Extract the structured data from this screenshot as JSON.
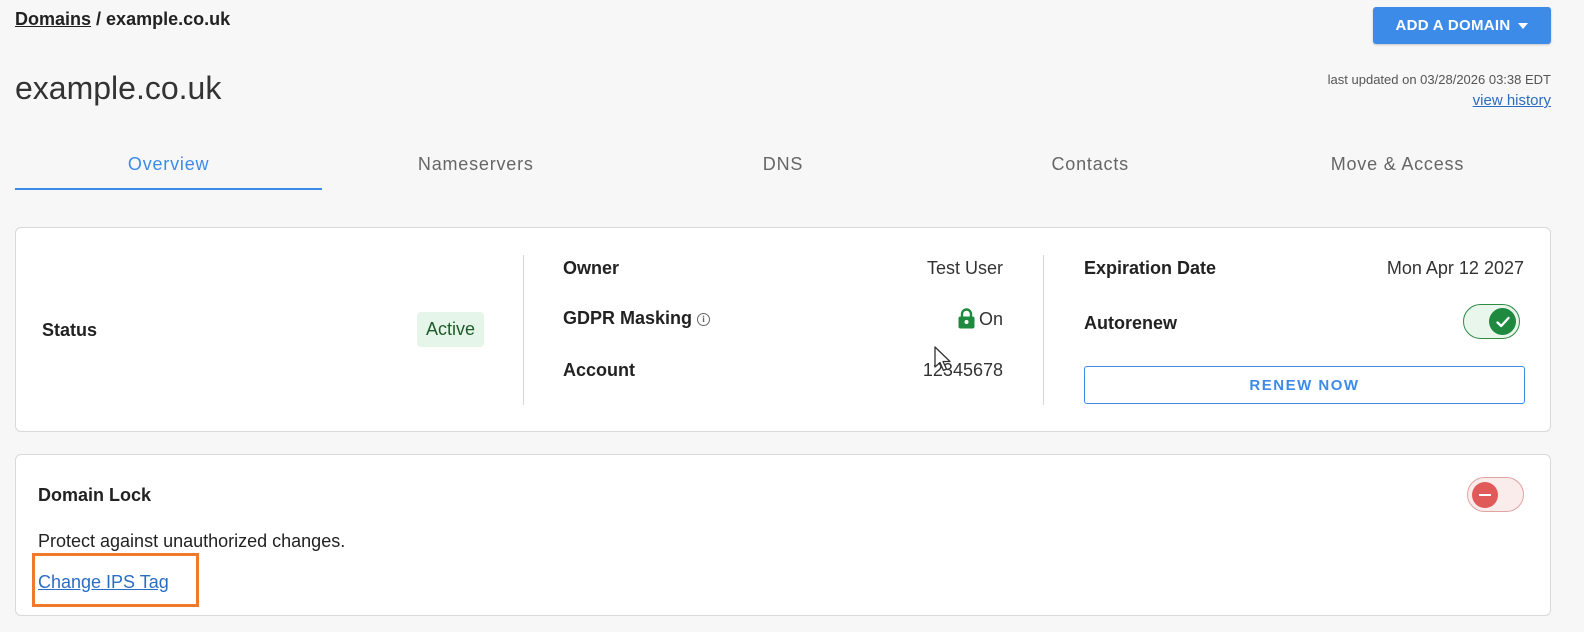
{
  "breadcrumb": {
    "root": "Domains",
    "separator": " / ",
    "current": "example.co.uk"
  },
  "header": {
    "add_domain_label": "ADD A DOMAIN",
    "title": "example.co.uk",
    "last_updated": "last updated on 03/28/2026 03:38 EDT",
    "view_history": "view history"
  },
  "tabs": [
    {
      "label": "Overview",
      "active": true
    },
    {
      "label": "Nameservers",
      "active": false
    },
    {
      "label": "DNS",
      "active": false
    },
    {
      "label": "Contacts",
      "active": false
    },
    {
      "label": "Move & Access",
      "active": false
    }
  ],
  "summary": {
    "status_label": "Status",
    "status_value": "Active",
    "owner_label": "Owner",
    "owner_value": "Test User",
    "gdpr_label": "GDPR Masking",
    "gdpr_value": "On",
    "account_label": "Account",
    "account_value": "12345678",
    "expiration_label": "Expiration Date",
    "expiration_value": "Mon Apr 12 2027",
    "autorenew_label": "Autorenew",
    "autorenew_on": true,
    "renew_label": "RENEW NOW"
  },
  "domain_lock": {
    "title": "Domain Lock",
    "description": "Protect against unauthorized changes.",
    "locked": false,
    "ips_link": "Change IPS Tag"
  },
  "colors": {
    "accent": "#3d8be8",
    "success": "#1f8a3f",
    "danger": "#e05a5a",
    "highlight": "#f07a2c"
  }
}
